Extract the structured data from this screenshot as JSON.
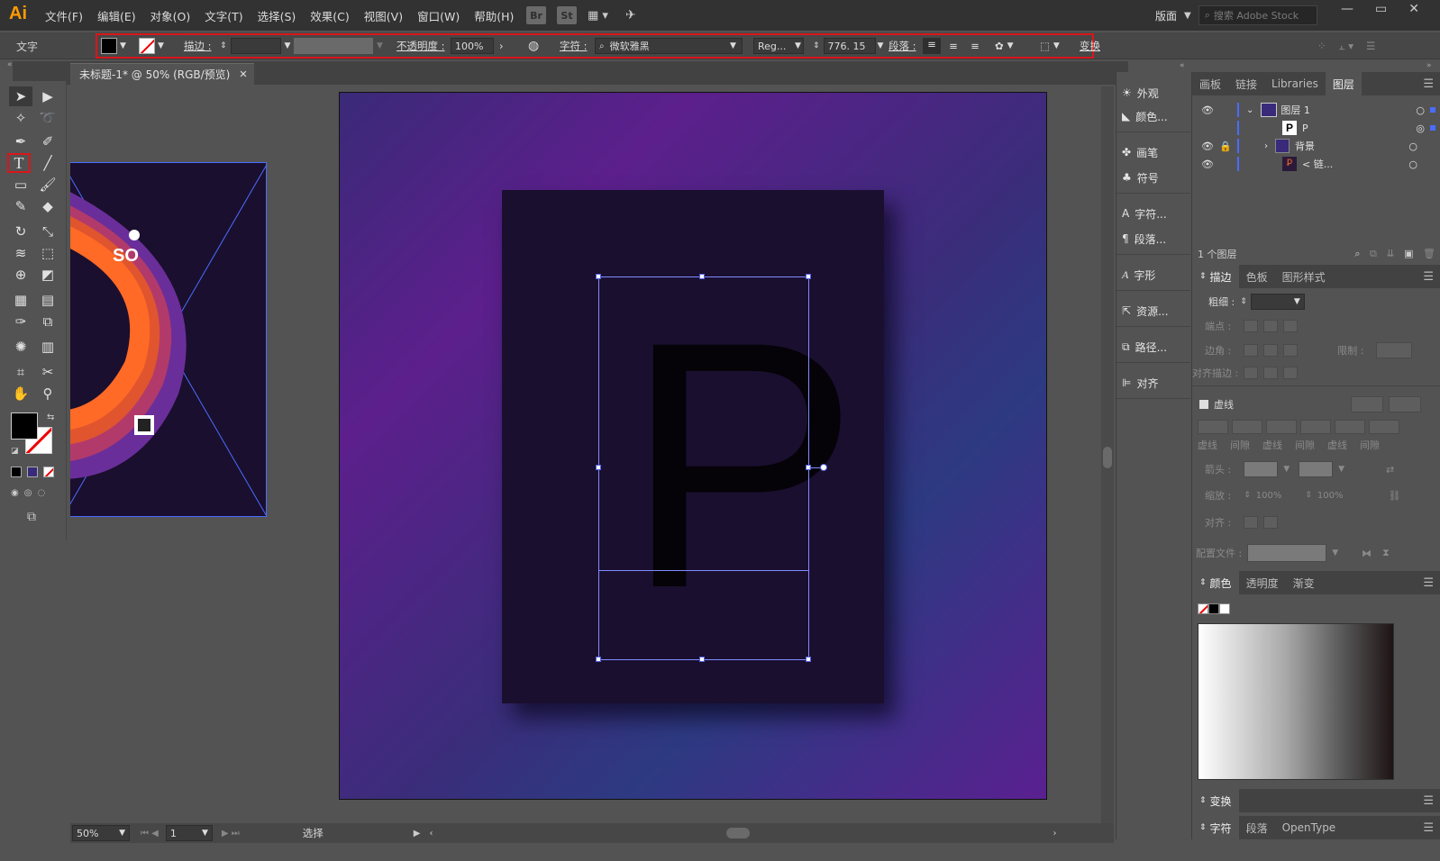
{
  "app": {
    "logo": "Ai"
  },
  "menubar": {
    "items": [
      "文件(F)",
      "编辑(E)",
      "对象(O)",
      "文字(T)",
      "选择(S)",
      "效果(C)",
      "视图(V)",
      "窗口(W)",
      "帮助(H)"
    ],
    "apps": [
      "Br",
      "St"
    ],
    "workspace": "版面",
    "search_placeholder": "搜索 Adobe Stock"
  },
  "control_bar": {
    "tool_label": "文字",
    "stroke_label": "描边 :",
    "opacity_label": "不透明度 :",
    "opacity_value": "100%",
    "char_label": "字符 :",
    "font_family": "微软雅黑",
    "font_style": "Reg...",
    "font_size": "776. 15",
    "paragraph_label": "段落 :",
    "transform_label": "变换"
  },
  "document": {
    "tab_title": "未标题-1* @ 50% (RGB/预览)",
    "artboard_letter": "P",
    "thumb_text": "SO"
  },
  "status_bar": {
    "zoom": "50%",
    "page": "1",
    "status_text": "选择"
  },
  "mid_panel": {
    "items": [
      "外观",
      "颜色...",
      "画笔",
      "符号",
      "字符...",
      "段落...",
      "字形",
      "资源...",
      "路径...",
      "对齐"
    ]
  },
  "layers_panel": {
    "tabs": [
      "画板",
      "链接",
      "Libraries",
      "图层"
    ],
    "active_tab": "图层",
    "layers": [
      {
        "name": "图层 1"
      },
      {
        "name": "P"
      },
      {
        "name": "背景"
      },
      {
        "name": "< 链..."
      }
    ],
    "footer": "1 个图层"
  },
  "stroke_panel": {
    "tabs": [
      "描边",
      "色板",
      "图形样式"
    ],
    "weight_label": "粗细 :",
    "cap_label": "端点 :",
    "corner_label": "边角 :",
    "limit_label": "限制 :",
    "align_label": "对齐描边 :",
    "dashed_label": "虚线",
    "dash_labels": [
      "虚线",
      "间隙",
      "虚线",
      "间隙",
      "虚线",
      "间隙"
    ],
    "arrow_label": "箭头 :",
    "scale_label": "缩放 :",
    "scale_values": [
      "100%",
      "100%"
    ],
    "align2_label": "对齐 :",
    "profile_label": "配置文件 :"
  },
  "color_panel": {
    "tabs": [
      "颜色",
      "透明度",
      "渐变"
    ]
  },
  "bottom_panels": {
    "transform_tab": "变换",
    "char_tabs": [
      "字符",
      "段落",
      "OpenType"
    ]
  }
}
